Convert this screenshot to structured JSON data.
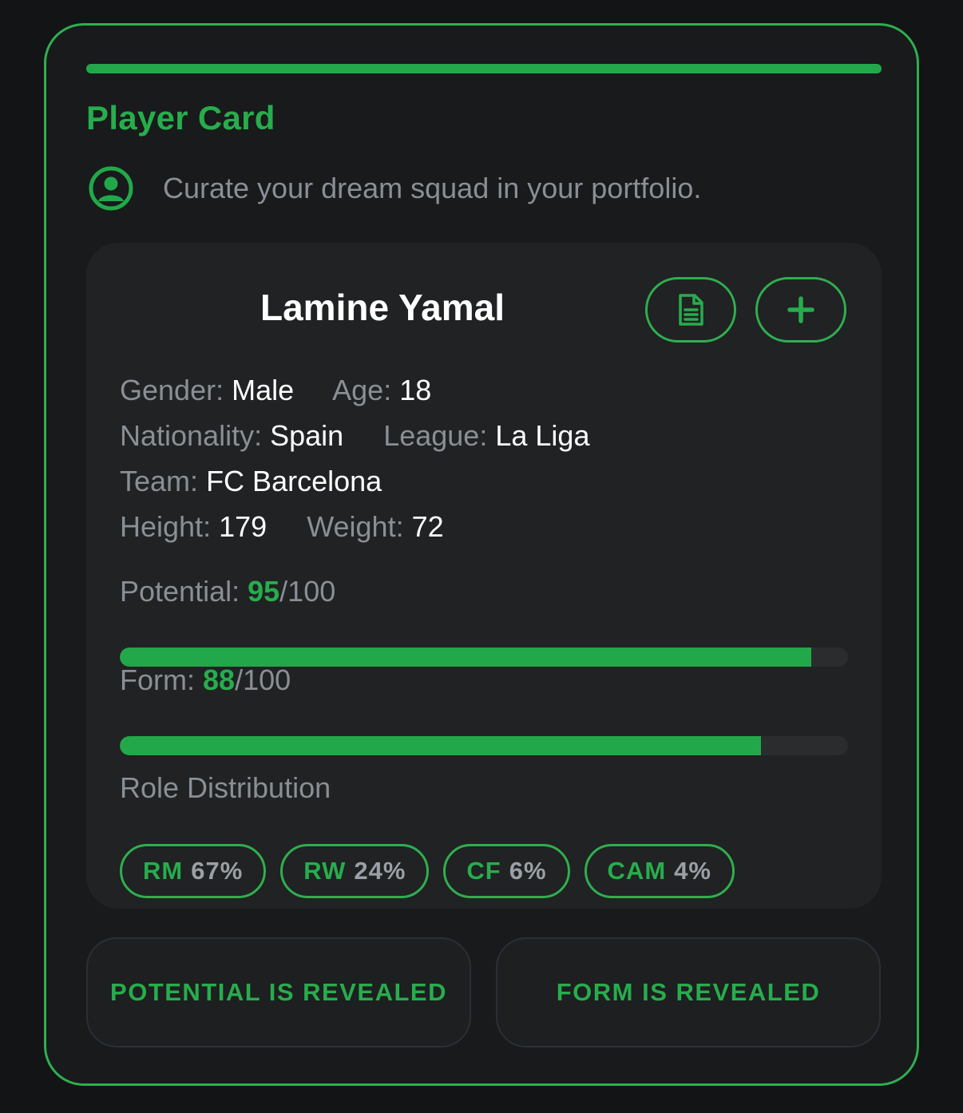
{
  "card": {
    "title": "Player Card",
    "subtitle": "Curate your dream squad in your portfolio.",
    "icon": "user-circle-icon"
  },
  "player": {
    "name": "Lamine Yamal",
    "actions": [
      {
        "icon": "document-icon"
      },
      {
        "icon": "plus-icon"
      }
    ],
    "labels": {
      "gender": "Gender:",
      "age": "Age:",
      "nationality": "Nationality:",
      "league": "League:",
      "team": "Team:",
      "height": "Height:",
      "weight": "Weight:"
    },
    "gender": "Male",
    "age": "18",
    "nationality": "Spain",
    "league": "La Liga",
    "team": "FC Barcelona",
    "height": "179",
    "weight": "72"
  },
  "metrics": {
    "potential": {
      "label": "Potential:",
      "value": "95",
      "max": "/100",
      "fraction": 0.95
    },
    "form": {
      "label": "Form:",
      "value": "88",
      "max": "/100",
      "fraction": 0.88
    }
  },
  "roles": {
    "heading": "Role Distribution",
    "items": [
      {
        "role": "RM",
        "pct": "67%"
      },
      {
        "role": "RW",
        "pct": "24%"
      },
      {
        "role": "CF",
        "pct": "6%"
      },
      {
        "role": "CAM",
        "pct": "4%"
      }
    ]
  },
  "reveal": {
    "potential_label": "POTENTIAL IS REVEALED",
    "form_label": "FORM IS REVEALED"
  },
  "colors": {
    "accent": "#27ad4c",
    "background": "#121416",
    "muted_text": "#8a8f95"
  }
}
